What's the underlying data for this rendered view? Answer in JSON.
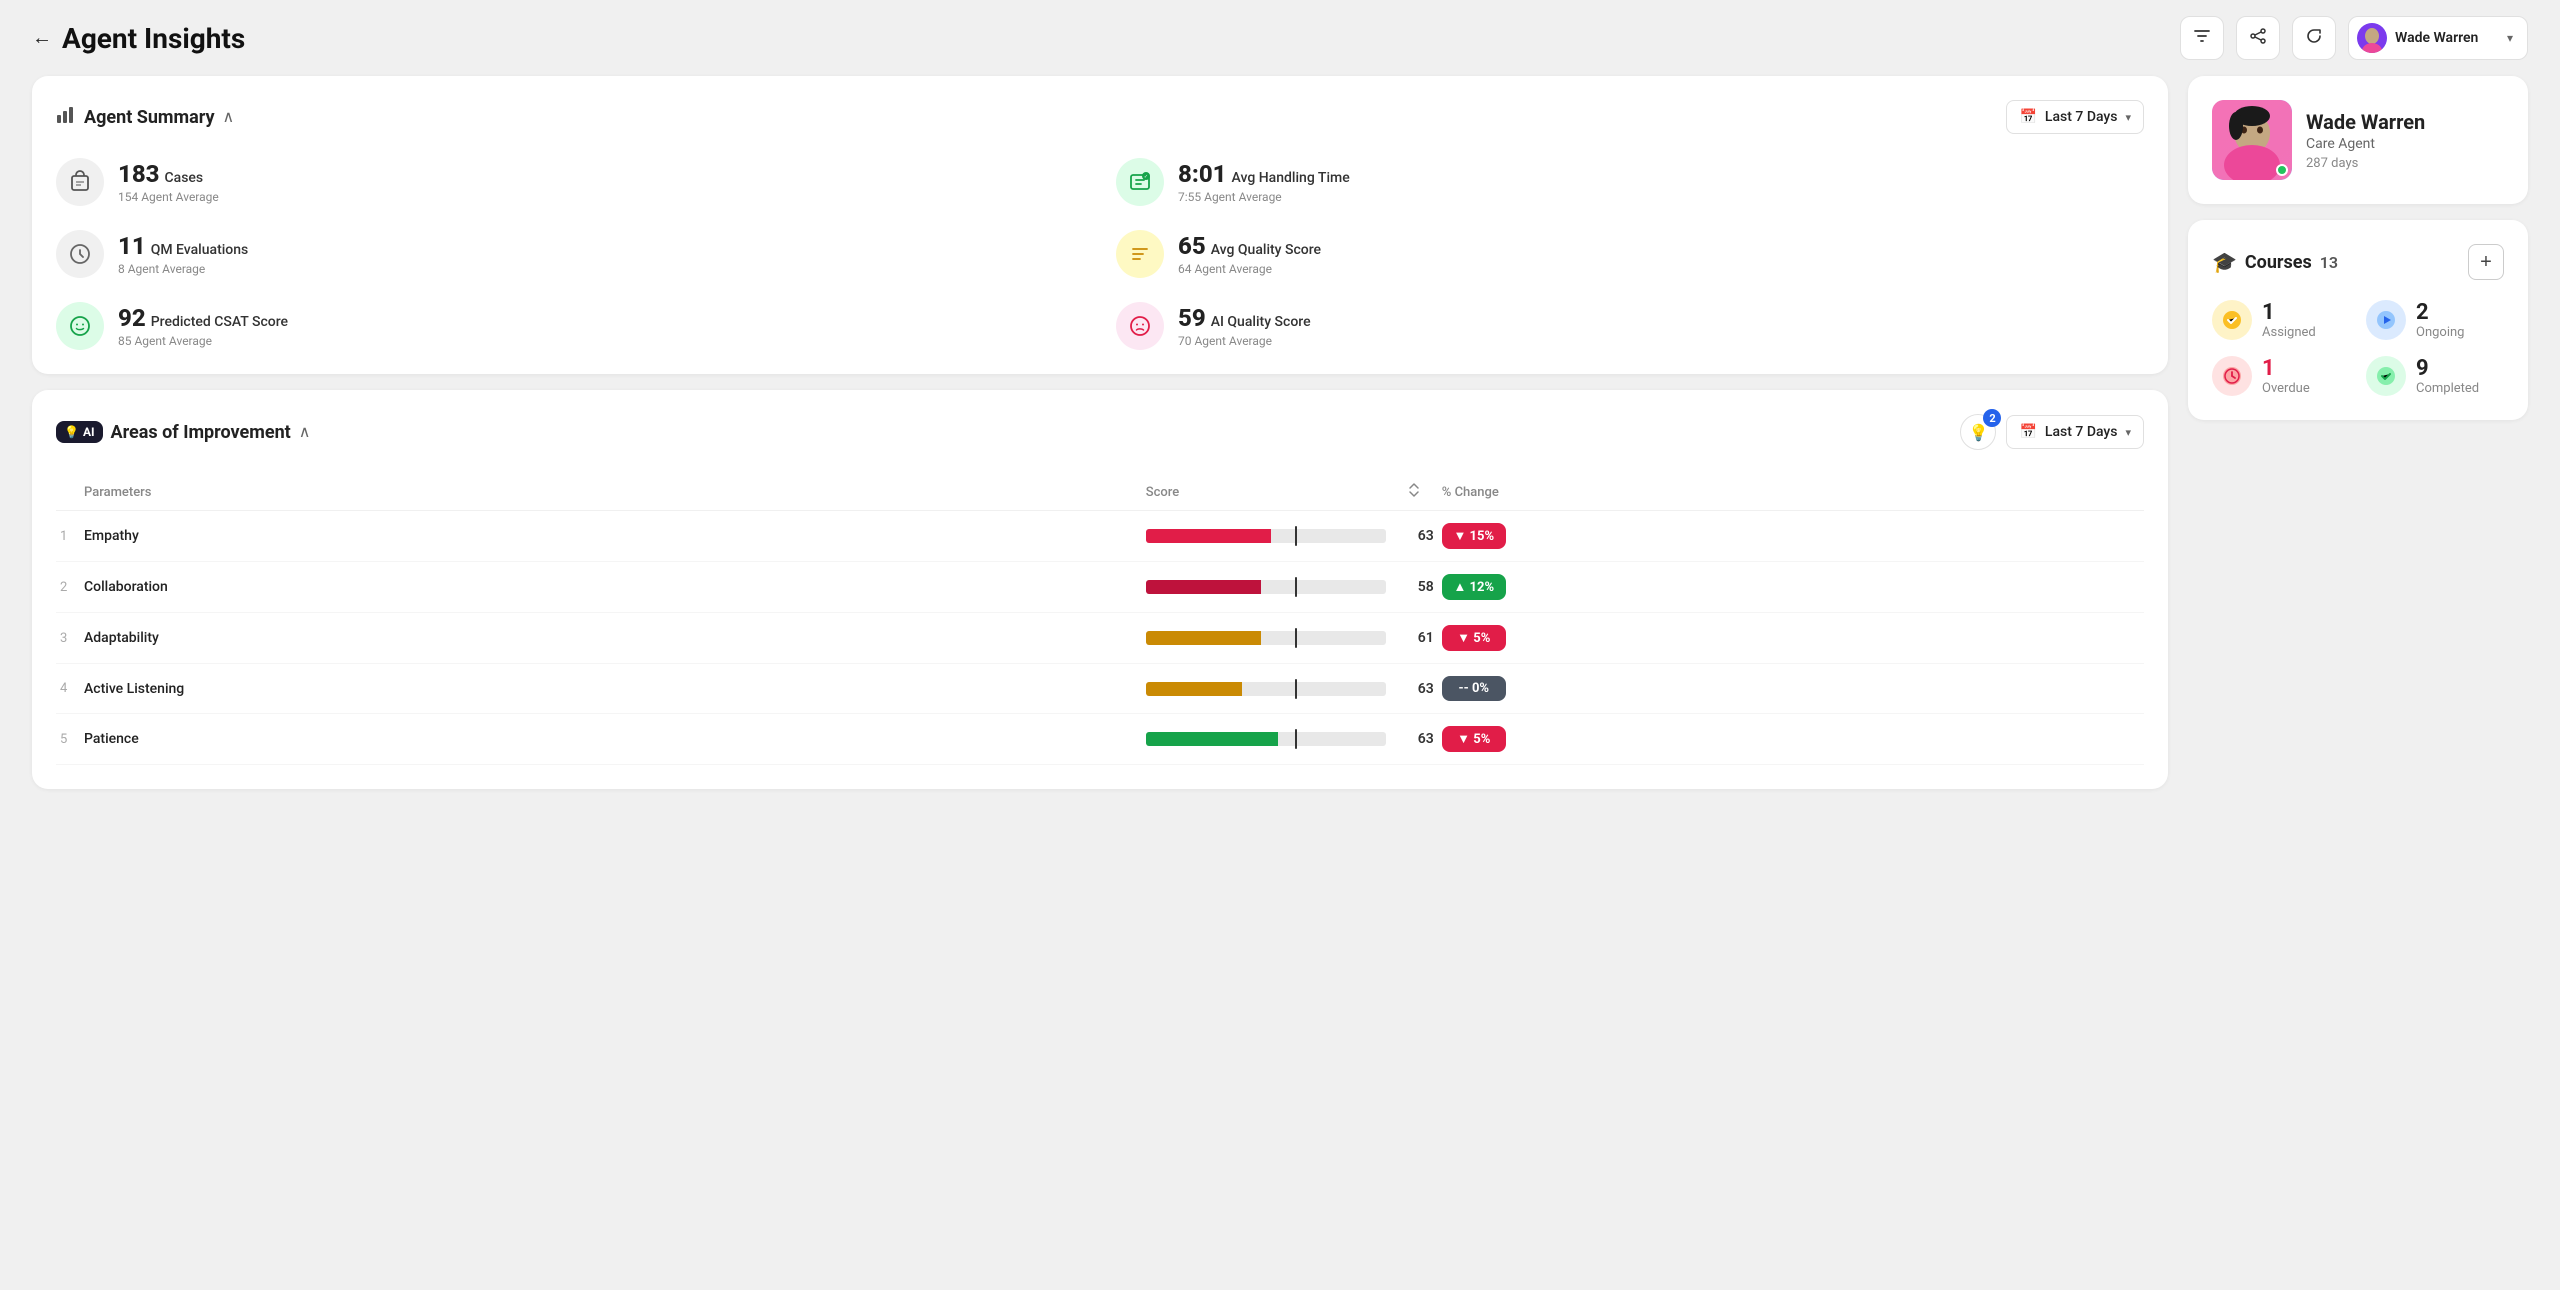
{
  "header": {
    "title": "Agent Insights",
    "back_label": "←",
    "icons": {
      "filter": "▼",
      "share": "⇗",
      "refresh": "↻"
    },
    "agent_selector": {
      "name": "Wade Warren",
      "chevron": "▾"
    }
  },
  "agent_summary": {
    "section_title": "Agent Summary",
    "date_label": "Last 7 Days",
    "stats": [
      {
        "id": "cases",
        "main_value": "183",
        "main_label": "Cases",
        "sub": "154 Agent Average",
        "icon": "📋",
        "icon_style": "gray"
      },
      {
        "id": "avg_handling_time",
        "main_value": "8:01",
        "main_label": "Avg Handling Time",
        "sub": "7:55 Agent Average",
        "icon": "💬",
        "icon_style": "green"
      },
      {
        "id": "qm_evaluations",
        "main_value": "11",
        "main_label": "QM Evaluations",
        "sub": "8 Agent Average",
        "icon": "⚙️",
        "icon_style": "gray"
      },
      {
        "id": "avg_quality_score",
        "main_value": "65",
        "main_label": "Avg Quality Score",
        "sub": "64 Agent Average",
        "icon": "≡",
        "icon_style": "yellow"
      },
      {
        "id": "predicted_csat",
        "main_value": "92",
        "main_label": "Predicted CSAT Score",
        "sub": "85 Agent Average",
        "icon": "😊",
        "icon_style": "green"
      },
      {
        "id": "ai_quality_score",
        "main_value": "59",
        "main_label": "AI Quality Score",
        "sub": "70 Agent Average",
        "icon": "😟",
        "icon_style": "pink"
      }
    ]
  },
  "areas_of_improvement": {
    "section_title": "Areas of Improvement",
    "badge_label": "AI",
    "badge_icon": "💡",
    "badge_count": "2",
    "date_label": "Last 7 Days",
    "columns": {
      "parameters": "Parameters",
      "score": "Score",
      "pct_change": "% Change"
    },
    "rows": [
      {
        "rank": "1",
        "name": "Empathy",
        "score": 63,
        "bar_pct": 52,
        "bar_color": "#e11d48",
        "midline_pct": 62,
        "pct_change": "▼ 15%",
        "pct_style": "red"
      },
      {
        "rank": "2",
        "name": "Collaboration",
        "score": 58,
        "bar_pct": 48,
        "bar_color": "#be123c",
        "midline_pct": 62,
        "pct_change": "▲ 12%",
        "pct_style": "green"
      },
      {
        "rank": "3",
        "name": "Adaptability",
        "score": 61,
        "bar_pct": 48,
        "bar_color": "#ca8a04",
        "midline_pct": 62,
        "pct_change": "▼ 5%",
        "pct_style": "red"
      },
      {
        "rank": "4",
        "name": "Active Listening",
        "score": 63,
        "bar_pct": 40,
        "bar_color": "#ca8a04",
        "midline_pct": 62,
        "pct_change": "-- 0%",
        "pct_style": "gray"
      },
      {
        "rank": "5",
        "name": "Patience",
        "score": 63,
        "bar_pct": 55,
        "bar_color": "#16a34a",
        "midline_pct": 62,
        "pct_change": "▼ 5%",
        "pct_style": "red"
      }
    ]
  },
  "agent_profile": {
    "name": "Wade Warren",
    "role": "Care Agent",
    "days": "287 days"
  },
  "courses": {
    "title": "Courses",
    "count": "13",
    "add_label": "+",
    "items": [
      {
        "id": "assigned",
        "value": "1",
        "label": "Assigned",
        "icon": "✓",
        "icon_style": "yellow"
      },
      {
        "id": "ongoing",
        "value": "2",
        "label": "Ongoing",
        "icon": "▶",
        "icon_style": "blue"
      },
      {
        "id": "overdue",
        "value": "1",
        "label": "Overdue",
        "icon": "🕐",
        "icon_style": "red",
        "value_style": "red"
      },
      {
        "id": "completed",
        "value": "9",
        "label": "Completed",
        "icon": "✓",
        "icon_style": "green"
      }
    ]
  }
}
